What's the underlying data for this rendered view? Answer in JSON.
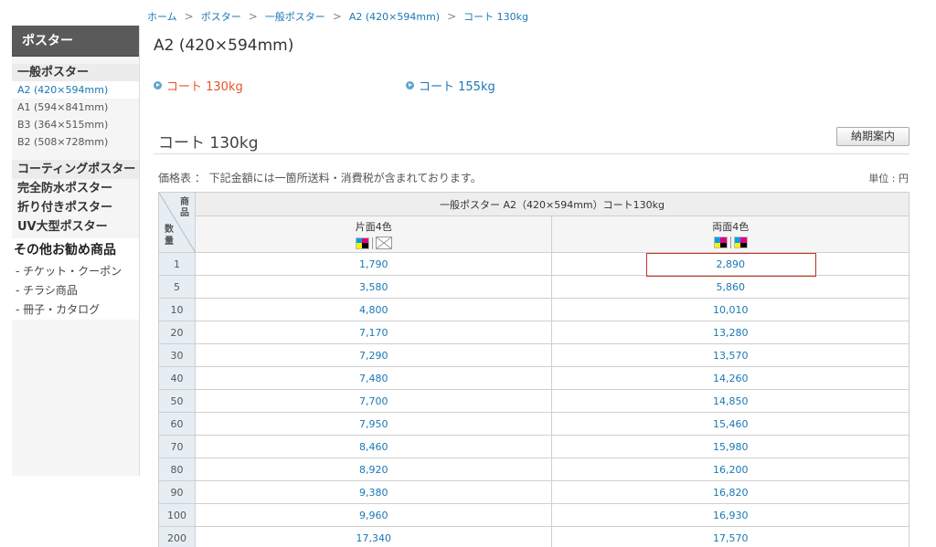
{
  "breadcrumb": [
    "ホーム",
    "ポスター",
    "一般ポスター",
    "A2 (420×594mm)",
    "コート 130kg"
  ],
  "breadcrumb_sep": ">",
  "sidebar": {
    "header": "ポスター",
    "group_title": "一般ポスター",
    "sizes": [
      "A2 (420×594mm)",
      "A1 (594×841mm)",
      "B3 (364×515mm)",
      "B2 (508×728mm)"
    ],
    "links": [
      "コーティングポスター",
      "完全防水ポスター",
      "折り付きポスター",
      "UV大型ポスター"
    ],
    "other_title": "その他お勧め商品",
    "other_items": [
      "- チケット・クーポン",
      "- チラシ商品",
      "- 冊子・カタログ"
    ]
  },
  "page_title": "A2 (420×594mm)",
  "paper_links": [
    "コート 130kg",
    "コート 155kg"
  ],
  "section_title": "コート 130kg",
  "delivery_button": "納期案内",
  "price_note": "価格表 ： 下記金額には一箇所送料・消費税が含まれております。",
  "unit_note": "単位 : 円",
  "table": {
    "corner_product": "商品",
    "corner_qty": "数量",
    "main_header": "一般ポスター A2（420×594mm）コート130kg",
    "col1": "片面4色",
    "col2": "両面4色",
    "rows": [
      {
        "qty": "1",
        "single": "1,790",
        "double": "2,890"
      },
      {
        "qty": "5",
        "single": "3,580",
        "double": "5,860"
      },
      {
        "qty": "10",
        "single": "4,800",
        "double": "10,010"
      },
      {
        "qty": "20",
        "single": "7,170",
        "double": "13,280"
      },
      {
        "qty": "30",
        "single": "7,290",
        "double": "13,570"
      },
      {
        "qty": "40",
        "single": "7,480",
        "double": "14,260"
      },
      {
        "qty": "50",
        "single": "7,700",
        "double": "14,850"
      },
      {
        "qty": "60",
        "single": "7,950",
        "double": "15,460"
      },
      {
        "qty": "70",
        "single": "8,460",
        "double": "15,980"
      },
      {
        "qty": "80",
        "single": "8,920",
        "double": "16,200"
      },
      {
        "qty": "90",
        "single": "9,380",
        "double": "16,820"
      },
      {
        "qty": "100",
        "single": "9,960",
        "double": "16,930"
      },
      {
        "qty": "200",
        "single": "17,340",
        "double": "17,570"
      }
    ]
  },
  "colors": {
    "link": "#1a78b4",
    "active_paper": "#e8532a",
    "highlight": "#c8321e",
    "sidebar_header": "#5a5a5a"
  }
}
